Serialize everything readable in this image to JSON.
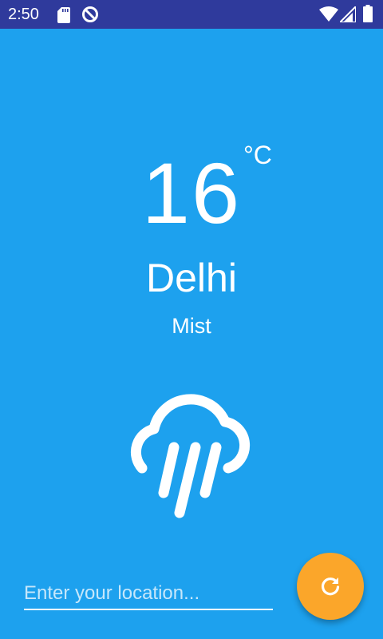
{
  "status_bar": {
    "time": "2:50",
    "icons": [
      "sd-card-icon",
      "data-saver-icon",
      "wifi-icon",
      "cell-signal-icon",
      "battery-icon"
    ]
  },
  "weather": {
    "temperature": "16",
    "unit": "°C",
    "city": "Delhi",
    "condition": "Mist",
    "icon": "rain-cloud-icon"
  },
  "search": {
    "placeholder": "Enter your location..."
  },
  "fab": {
    "icon": "refresh-icon"
  },
  "colors": {
    "background": "#1DA1EE",
    "status_bar": "#2F3A9C",
    "fab": "#FBA62A",
    "text": "#FFFFFF"
  }
}
